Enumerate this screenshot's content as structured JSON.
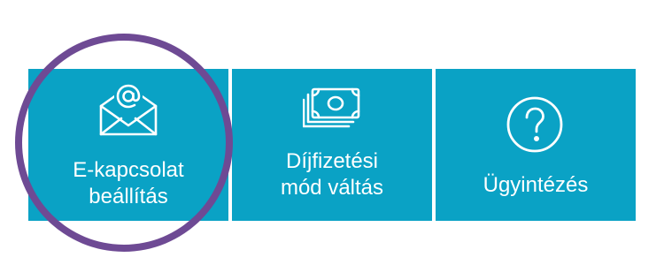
{
  "colors": {
    "tile_background": "#0aa2c5",
    "tile_text": "#ffffff",
    "highlight_ring": "#6e4a94",
    "page_background": "#ffffff"
  },
  "tiles": [
    {
      "label": "E-kapcsolat\nbeállítás",
      "icon": "envelope-at-icon"
    },
    {
      "label": "Díjfizetési\nmód váltás",
      "icon": "banknotes-icon"
    },
    {
      "label": "Ügyintézés",
      "icon": "question-circle-icon"
    }
  ]
}
